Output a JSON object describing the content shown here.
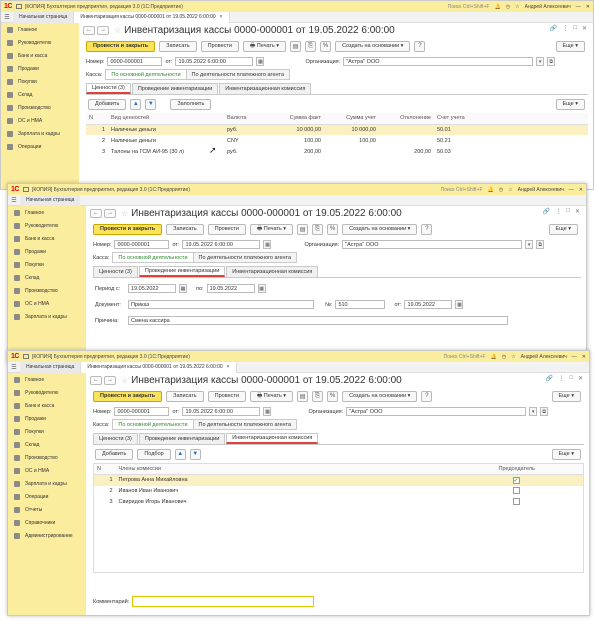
{
  "app_title": "[КОПИЯ] Бухгалтерия предприятия, редакция 3.0  (1С:Предприятие)",
  "search_placeholder": "Поиск Ctrl+Shift+F",
  "user": "Андрей Алексеевич",
  "home_tab": "Начальная страница",
  "doc_tab": "Инвентаризация кассы 0000-000001 от 19.05.2022 6:00:00",
  "doc_title": "Инвентаризация кассы 0000-000001 от 19.05.2022 6:00:00",
  "sidebar": [
    "Главное",
    "Руководителю",
    "Банк и касса",
    "Продажи",
    "Покупки",
    "Склад",
    "Производство",
    "ОС и НМА",
    "Зарплата и кадры",
    "Операции",
    "Отчеты",
    "Справочники",
    "Администрирование"
  ],
  "buttons": {
    "post_close": "Провести и закрыть",
    "save": "Записать",
    "post": "Провести",
    "print": "Печать",
    "create_based": "Создать на основании",
    "help": "?",
    "more": "Еще"
  },
  "fields": {
    "number_label": "Номер:",
    "number": "0000-000001",
    "date_label": "от:",
    "date": "19.05.2022  6:00:00",
    "org_label": "Организация:",
    "org": "\"Астра\" ООО",
    "cash_label": "Касса:",
    "cash_main": "По основной деятельности",
    "cash_agent": "По деятельности платежного агента"
  },
  "tabs": {
    "values": "Ценности (3)",
    "conduct": "Проведение инвентаризации",
    "commission": "Инвентаризационная комиссия"
  },
  "w1": {
    "add": "Добавить",
    "fill": "Заполнить",
    "more": "Еще",
    "columns": [
      "N",
      "Вид ценностей",
      "Валюта",
      "Сумма факт",
      "Сумма учет",
      "Отклонение",
      "Счет учета"
    ],
    "rows": [
      [
        "1",
        "Наличные деньги",
        "руб.",
        "10 000,00",
        "10 000,00",
        "",
        "50.01"
      ],
      [
        "2",
        "Наличные деньги",
        "CNY",
        "100,00",
        "100,00",
        "",
        "50.21"
      ],
      [
        "3",
        "Талоны на ГСМ АИ-95 (30 л)",
        "руб.",
        "200,00",
        "",
        "200,00",
        "50.03"
      ]
    ]
  },
  "w2": {
    "period_from_label": "Период с:",
    "period_from": "19.05.2022",
    "period_to_label": "по:",
    "period_to": "19.05.2022",
    "doc_label": "Документ:",
    "doc": "Приказ",
    "doc_no_label": "№:",
    "doc_no": "510",
    "doc_date_label": "от:",
    "doc_date": "19.05.2022",
    "reason_label": "Причина:",
    "reason": "Смена кассира"
  },
  "w3": {
    "add": "Добавить",
    "select": "Подбор",
    "more": "Еще",
    "col_n": "N",
    "col_members": "Члены комиссии",
    "col_chair": "Председатель",
    "rows": [
      {
        "n": "1",
        "name": "Петрова Анна Михайловна",
        "chair": "✓"
      },
      {
        "n": "2",
        "name": "Иванов Иван Иванович",
        "chair": ""
      },
      {
        "n": "3",
        "name": "Свиридов Игорь Иванович",
        "chair": ""
      }
    ],
    "comment_label": "Комментарий:"
  }
}
